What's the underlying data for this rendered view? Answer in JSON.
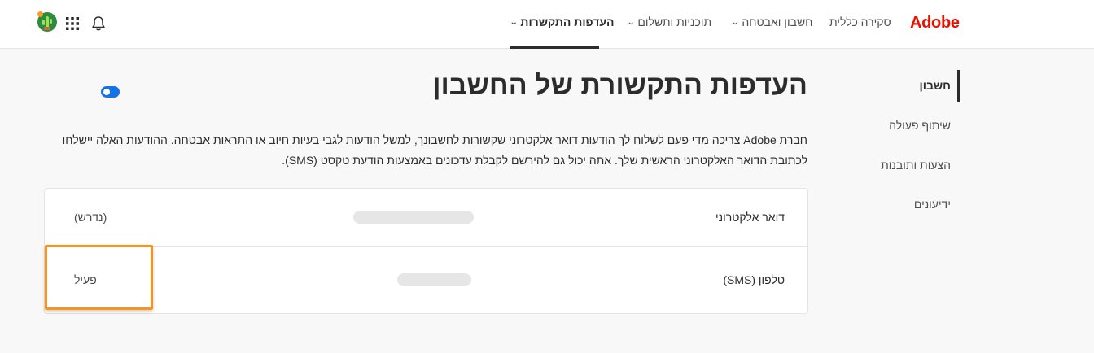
{
  "colors": {
    "brand": "#eb1000",
    "accent": "#1473e6",
    "highlight": "#f7941d"
  },
  "header": {
    "logo": "Adobe",
    "nav": [
      {
        "label": "סקירה כללית",
        "has_dropdown": false,
        "active": false
      },
      {
        "label": "חשבון ואבטחה",
        "has_dropdown": true,
        "active": false
      },
      {
        "label": "תוכניות ותשלום",
        "has_dropdown": true,
        "active": false
      },
      {
        "label": "העדפות התקשרות",
        "has_dropdown": true,
        "active": true
      }
    ],
    "icons": [
      "bell-icon",
      "apps-grid-icon",
      "avatar"
    ]
  },
  "sidebar": {
    "items": [
      {
        "label": "חשבון",
        "active": true
      },
      {
        "label": "שיתוף פעולה",
        "active": false
      },
      {
        "label": "הצעות ותובנות",
        "active": false
      },
      {
        "label": "ידיעונים",
        "active": false
      }
    ]
  },
  "main": {
    "title": "העדפות התקשורת של החשבון",
    "description_line1": "חברת Adobe צריכה מדי פעם לשלוח לך הודעות דואר אלקטרוני שקשורות לחשבונך, למשל הודעות לגבי בעיות חיוב או התראות אבטחה. ההודעות האלה יישלחו",
    "description_line2": "לכתובת הדואר האלקטרוני הראשית שלך. אתה יכול גם להירשם לקבלת עדכונים באמצעות הודעת טקסט (SMS).",
    "rows": [
      {
        "label": "דואר אלקטרוני",
        "value_hidden": true,
        "meta": "(נדרש)"
      },
      {
        "label": "טלפון (SMS)",
        "value_hidden": true,
        "toggle_label": "פעיל",
        "toggle_on": true
      }
    ]
  }
}
